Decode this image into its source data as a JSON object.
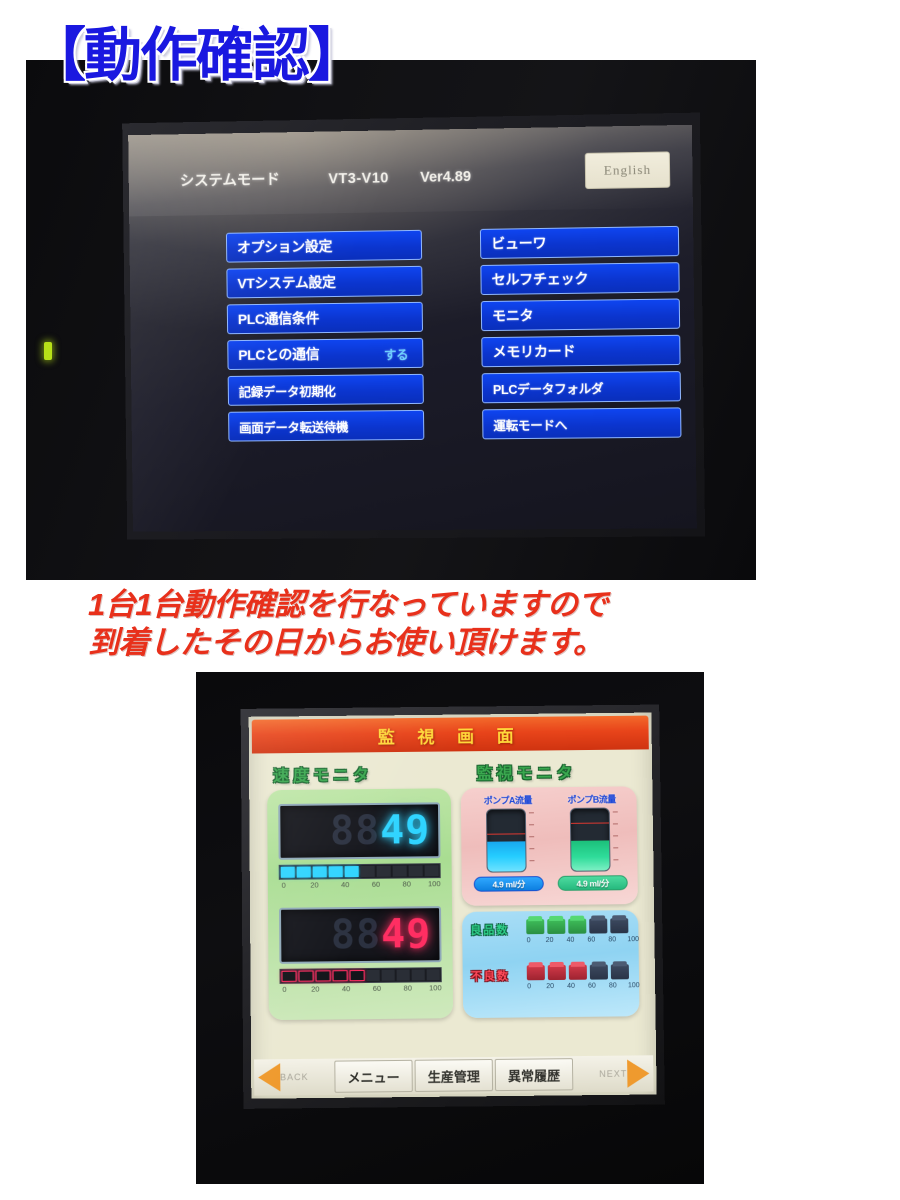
{
  "page": {
    "title": "【動作確認】",
    "note_line1": "1台1台動作確認を行なっていますので",
    "note_line2": "到着したその日からお使い頂けます。"
  },
  "system_screen": {
    "header": {
      "mode": "システムモード",
      "model": "VT3-V10",
      "version": "Ver4.89",
      "language_button": "English"
    },
    "left_buttons": [
      {
        "label": "オプション設定",
        "value": ""
      },
      {
        "label": "VTシステム設定",
        "value": ""
      },
      {
        "label": "PLC通信条件",
        "value": ""
      },
      {
        "label": "PLCとの通信",
        "value": "する"
      },
      {
        "label": "記録データ初期化",
        "value": ""
      },
      {
        "label": "画面データ転送待機",
        "value": ""
      }
    ],
    "right_buttons": [
      {
        "label": "ビューワ",
        "value": ""
      },
      {
        "label": "セルフチェック",
        "value": ""
      },
      {
        "label": "モニタ",
        "value": ""
      },
      {
        "label": "メモリカード",
        "value": ""
      },
      {
        "label": "PLCデータフォルダ",
        "value": ""
      },
      {
        "label": "運転モードへ",
        "value": ""
      }
    ]
  },
  "monitor_screen": {
    "title": "監 視 画 面",
    "speed_section": {
      "heading": "速度モニタ"
    },
    "monitor_section": {
      "heading": "監視モニタ"
    },
    "meters": [
      {
        "name": "speed-meter-1",
        "off_digits": "88",
        "value": "49",
        "color": "#2fd4ff",
        "segments_on": 5,
        "segments_total": 10
      },
      {
        "name": "speed-meter-2",
        "off_digits": "88",
        "value": "49",
        "color": "#ff2e62",
        "segments_on": 5,
        "segments_total": 10
      }
    ],
    "scale_ticks": [
      "0",
      "20",
      "40",
      "60",
      "80",
      "100"
    ],
    "pumps": [
      {
        "label": "ポンプA流量",
        "value": "4.9 ml/分",
        "fill_percent": 49,
        "color": "#25cdff"
      },
      {
        "label": "ポンプB流量",
        "value": "4.9 ml/分",
        "fill_percent": 49,
        "color": "#2fdc9a"
      }
    ],
    "counts": [
      {
        "label": "良品数",
        "on": 3,
        "total": 5,
        "color": "#2fd08a"
      },
      {
        "label": "不良数",
        "on": 3,
        "total": 5,
        "color": "#ff4a5a"
      }
    ],
    "toolbar": {
      "back": "BACK",
      "menu": "メニュー",
      "production": "生産管理",
      "history": "異常履歴",
      "next": "NEXT"
    }
  },
  "chart_data": {
    "type": "bar",
    "title": "監 視 画 面",
    "categories": [
      "速度モニタ1",
      "速度モニタ2",
      "ポンプA流量",
      "ポンプB流量",
      "良品数",
      "不良数"
    ],
    "values": [
      49,
      49,
      49,
      49,
      60,
      60
    ],
    "xlabel": "",
    "ylabel": "",
    "ylim": [
      0,
      100
    ],
    "tick_labels": [
      "0",
      "20",
      "40",
      "60",
      "80",
      "100"
    ],
    "units": [
      "%",
      "%",
      "ml/分",
      "ml/分",
      "%",
      "%"
    ],
    "grid": false,
    "legend": "none"
  }
}
